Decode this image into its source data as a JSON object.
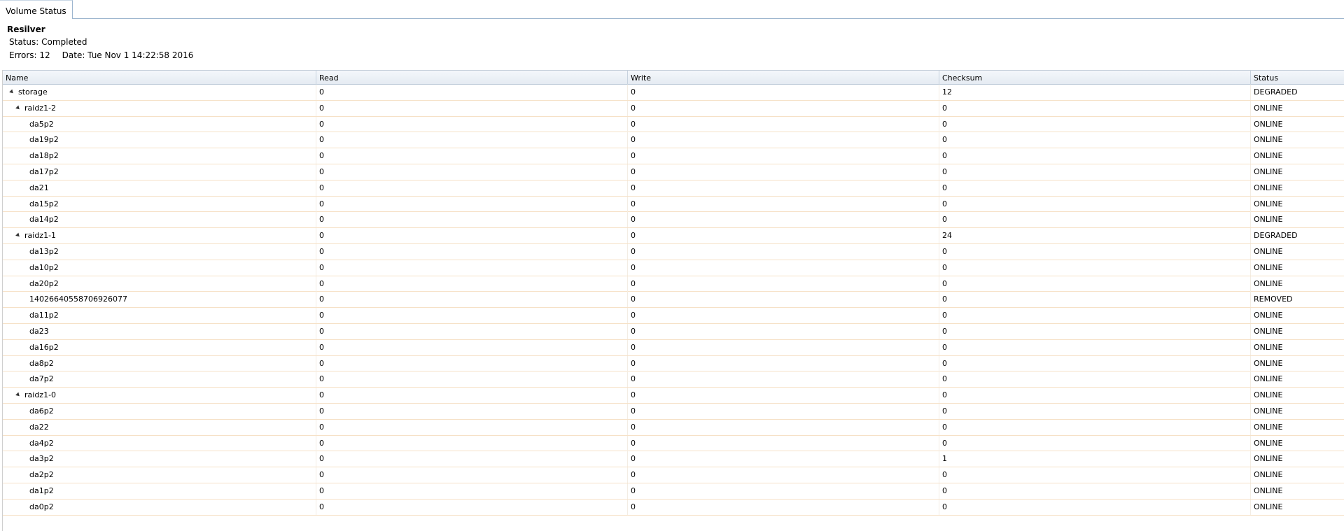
{
  "tab": {
    "label": "Volume Status"
  },
  "scrub": {
    "title": "Resilver",
    "status": "Status: Completed",
    "errors": "Errors: 12",
    "date": "Date: Tue Nov 1 14:22:58 2016"
  },
  "columns": [
    "Name",
    "Read",
    "Write",
    "Checksum",
    "Status"
  ],
  "rows": [
    {
      "level": 0,
      "expander": true,
      "name": "storage",
      "read": "0",
      "write": "0",
      "checksum": "12",
      "status": "DEGRADED"
    },
    {
      "level": 1,
      "expander": true,
      "name": "raidz1-2",
      "read": "0",
      "write": "0",
      "checksum": "0",
      "status": "ONLINE"
    },
    {
      "level": 2,
      "expander": false,
      "name": "da5p2",
      "read": "0",
      "write": "0",
      "checksum": "0",
      "status": "ONLINE"
    },
    {
      "level": 2,
      "expander": false,
      "name": "da19p2",
      "read": "0",
      "write": "0",
      "checksum": "0",
      "status": "ONLINE"
    },
    {
      "level": 2,
      "expander": false,
      "name": "da18p2",
      "read": "0",
      "write": "0",
      "checksum": "0",
      "status": "ONLINE"
    },
    {
      "level": 2,
      "expander": false,
      "name": "da17p2",
      "read": "0",
      "write": "0",
      "checksum": "0",
      "status": "ONLINE"
    },
    {
      "level": 2,
      "expander": false,
      "name": "da21",
      "read": "0",
      "write": "0",
      "checksum": "0",
      "status": "ONLINE"
    },
    {
      "level": 2,
      "expander": false,
      "name": "da15p2",
      "read": "0",
      "write": "0",
      "checksum": "0",
      "status": "ONLINE"
    },
    {
      "level": 2,
      "expander": false,
      "name": "da14p2",
      "read": "0",
      "write": "0",
      "checksum": "0",
      "status": "ONLINE"
    },
    {
      "level": 1,
      "expander": true,
      "name": "raidz1-1",
      "read": "0",
      "write": "0",
      "checksum": "24",
      "status": "DEGRADED"
    },
    {
      "level": 2,
      "expander": false,
      "name": "da13p2",
      "read": "0",
      "write": "0",
      "checksum": "0",
      "status": "ONLINE"
    },
    {
      "level": 2,
      "expander": false,
      "name": "da10p2",
      "read": "0",
      "write": "0",
      "checksum": "0",
      "status": "ONLINE"
    },
    {
      "level": 2,
      "expander": false,
      "name": "da20p2",
      "read": "0",
      "write": "0",
      "checksum": "0",
      "status": "ONLINE"
    },
    {
      "level": 2,
      "expander": false,
      "name": "14026640558706926077",
      "read": "0",
      "write": "0",
      "checksum": "0",
      "status": "REMOVED"
    },
    {
      "level": 2,
      "expander": false,
      "name": "da11p2",
      "read": "0",
      "write": "0",
      "checksum": "0",
      "status": "ONLINE"
    },
    {
      "level": 2,
      "expander": false,
      "name": "da23",
      "read": "0",
      "write": "0",
      "checksum": "0",
      "status": "ONLINE"
    },
    {
      "level": 2,
      "expander": false,
      "name": "da16p2",
      "read": "0",
      "write": "0",
      "checksum": "0",
      "status": "ONLINE"
    },
    {
      "level": 2,
      "expander": false,
      "name": "da8p2",
      "read": "0",
      "write": "0",
      "checksum": "0",
      "status": "ONLINE"
    },
    {
      "level": 2,
      "expander": false,
      "name": "da7p2",
      "read": "0",
      "write": "0",
      "checksum": "0",
      "status": "ONLINE"
    },
    {
      "level": 1,
      "expander": true,
      "name": "raidz1-0",
      "read": "0",
      "write": "0",
      "checksum": "0",
      "status": "ONLINE"
    },
    {
      "level": 2,
      "expander": false,
      "name": "da6p2",
      "read": "0",
      "write": "0",
      "checksum": "0",
      "status": "ONLINE"
    },
    {
      "level": 2,
      "expander": false,
      "name": "da22",
      "read": "0",
      "write": "0",
      "checksum": "0",
      "status": "ONLINE"
    },
    {
      "level": 2,
      "expander": false,
      "name": "da4p2",
      "read": "0",
      "write": "0",
      "checksum": "0",
      "status": "ONLINE"
    },
    {
      "level": 2,
      "expander": false,
      "name": "da3p2",
      "read": "0",
      "write": "0",
      "checksum": "1",
      "status": "ONLINE"
    },
    {
      "level": 2,
      "expander": false,
      "name": "da2p2",
      "read": "0",
      "write": "0",
      "checksum": "0",
      "status": "ONLINE"
    },
    {
      "level": 2,
      "expander": false,
      "name": "da1p2",
      "read": "0",
      "write": "0",
      "checksum": "0",
      "status": "ONLINE"
    },
    {
      "level": 2,
      "expander": false,
      "name": "da0p2",
      "read": "0",
      "write": "0",
      "checksum": "0",
      "status": "ONLINE"
    }
  ]
}
